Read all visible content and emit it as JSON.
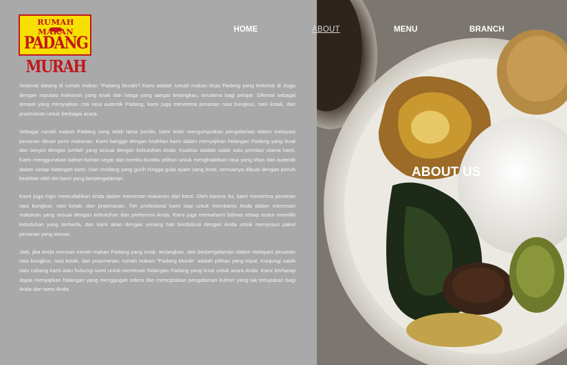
{
  "logo": {
    "line1": "RUMAH MAKAN",
    "line2": "PADANG MURAH"
  },
  "nav": {
    "items": [
      {
        "label": "HOME",
        "active": false
      },
      {
        "label": "ABOUT",
        "active": true
      },
      {
        "label": "MENU",
        "active": false
      },
      {
        "label": "BRANCH",
        "active": false
      }
    ]
  },
  "hero": {
    "title": "ABOUT US"
  },
  "content": {
    "paragraphs": [
      "Selamat datang di rumah makan \"Padang Murah\"! Kami adalah rumah makan khas Padang yang terkenal di Jogja dengan reputasi makanan yang enak dan harga yang sangat terjangkau, terutama bagi pelajar. Dikenal sebagai tempat yang menyajikan cita rasa autentik Padang, kami juga menerima pesanan nasi bungkus, nasi kotak, dan prasmanan untuk berbagai acara.",
      "Sebagai rumah makan Padang yang telah lama berdiri, kami telah mengumpulkan pengalaman dalam melayani pesanan ribuan porsi makanan. Kami bangga dengan keahlian kami dalam menyajikan hidangan Padang yang lezat dan bergizi dengan jumlah yang sesuai dengan kebutuhan Anda. Kualitas adalah salah satu prioritas utama kami. Kami menggunakan bahan-bahan segar dan bumbu-bumbu pilihan untuk menghadirkan rasa yang khas dan autentik dalam setiap hidangan kami. Dari rendang yang gurih hingga gulai ayam yang lezat, semuanya dibuat dengan penuh keahlian oleh tim kami yang berpengalaman.",
      "Kami juga ingin memudahkan Anda dalam memesan makanan dari kami. Oleh karena itu, kami menerima pesanan nasi bungkus, nasi kotak, dan prasmanan. Tim profesional kami siap untuk membantu Anda dalam memesan makanan yang sesuai dengan kebutuhan dan preferensi Anda. Kami juga memahami bahwa setiap acara memiliki kebutuhan yang berbeda, dan kami akan dengan senang hati berdiskusi dengan Anda untuk menyusun paket pesanan yang sesuai.",
      "Jadi, jika Anda mencari rumah makan Padang yang enak, terjangkau, dan berpengalaman dalam melayani pesanan nasi bungkus, nasi kotak, dan prasmanan, rumah makan \"Padang Murah\" adalah pilihan yang tepat. Kunjungi salah satu cabang kami atau hubungi kami untuk memesan hidangan Padang yang lezat untuk acara Anda. Kami berharap dapat menyajikan hidangan yang menggugah selera dan menciptakan pengalaman kuliner yang tak terlupakan bagi Anda dan tamu Anda."
    ]
  },
  "colors": {
    "left_panel": "#a9a9a9",
    "logo_bg": "#f7e000",
    "logo_text": "#c0171c",
    "text": "#ffffff"
  }
}
